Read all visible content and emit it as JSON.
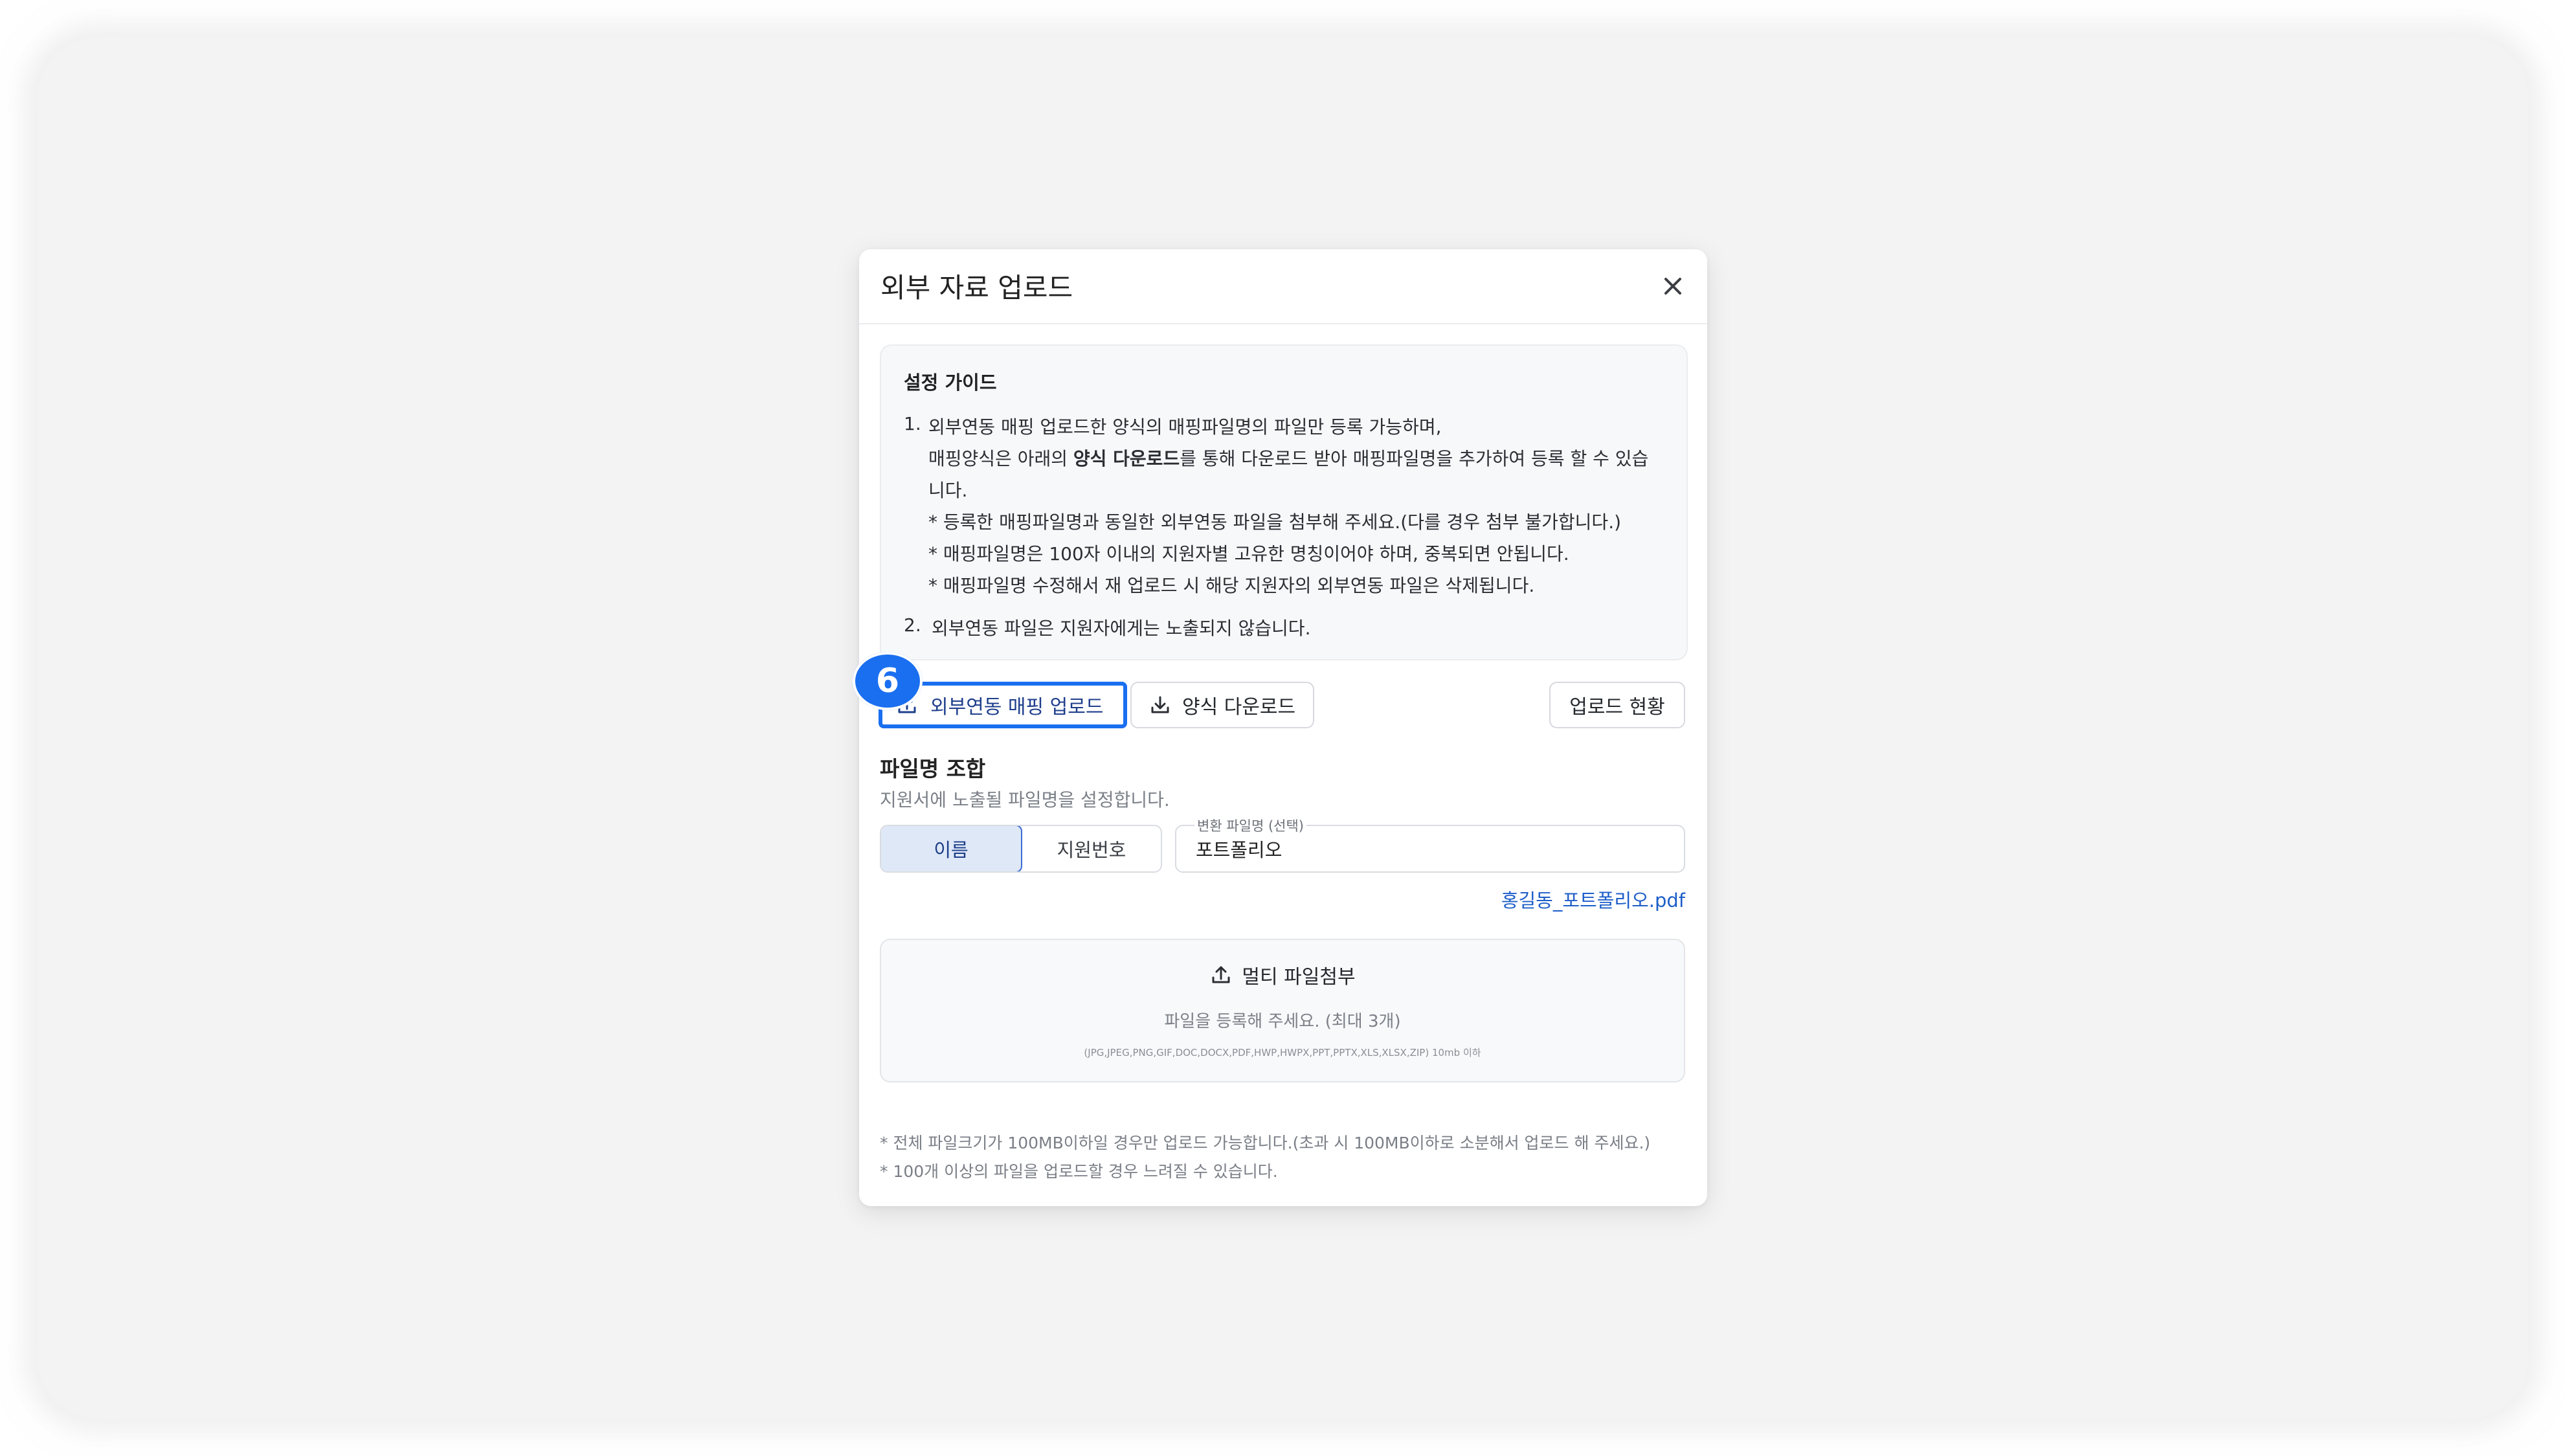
{
  "modal": {
    "title": "외부 자료 업로드",
    "close_icon": "close-icon"
  },
  "guide": {
    "title": "설정 가이드",
    "item1_num": "1.",
    "item1_line1": "외부연동 매핑 업로드한 양식의 매핑파일명의 파일만 등록 가능하며,",
    "item1_line2_pre": "매핑양식은 아래의 ",
    "item1_line2_bold": "양식 다운로드",
    "item1_line2_post": "를 통해 다운로드 받아 매핑파일명을 추가하여 등록 할 수 있습",
    "item1_line3": "니다.",
    "bullet1": "* 등록한 매핑파일명과 동일한 외부연동 파일을 첨부해 주세요.(다를 경우 첨부 불가합니다.)",
    "bullet2": "* 매핑파일명은 100자 이내의 지원자별 고유한 명칭이어야 하며, 중복되면 안됩니다.",
    "bullet3": "* 매핑파일명 수정해서 재 업로드 시 해당 지원자의 외부연동 파일은 삭제됩니다.",
    "item2_num": "2.",
    "item2": "외부연동 파일은 지원자에게는 노출되지 않습니다."
  },
  "actions": {
    "step_badge": "6",
    "mapping_upload": "외부연동 매핑 업로드",
    "template_download": "양식 다운로드",
    "upload_status": "업로드 현황"
  },
  "filename": {
    "title": "파일명 조합",
    "description": "지원서에 노출될 파일명을 설정합니다.",
    "options": [
      "이름",
      "지원번호"
    ],
    "selected": "이름",
    "field_label": "변환 파일명 (선택)",
    "field_value": "포트폴리오",
    "preview": "홍길동_포트폴리오.pdf"
  },
  "dropzone": {
    "label": "멀티 파일첨부",
    "hint": "파일을 등록해 주세요. (최대 3개)",
    "formats": "(JPG,JPEG,PNG,GIF,DOC,DOCX,PDF,HWP,HWPX,PPT,PPTX,XLS,XLSX,ZIP) 10mb 이하"
  },
  "notes": [
    "* 전체 파일크기가 100MB이하일 경우만 업로드 가능합니다.(초과 시 100MB이하로 소분해서 업로드 해 주세요.)",
    "* 100개 이상의 파일을 업로드할 경우 느려질 수 있습니다."
  ],
  "colors": {
    "accent": "#1a6ff0",
    "selected_bg": "#dfe8f7",
    "link": "#1d5ec9"
  }
}
